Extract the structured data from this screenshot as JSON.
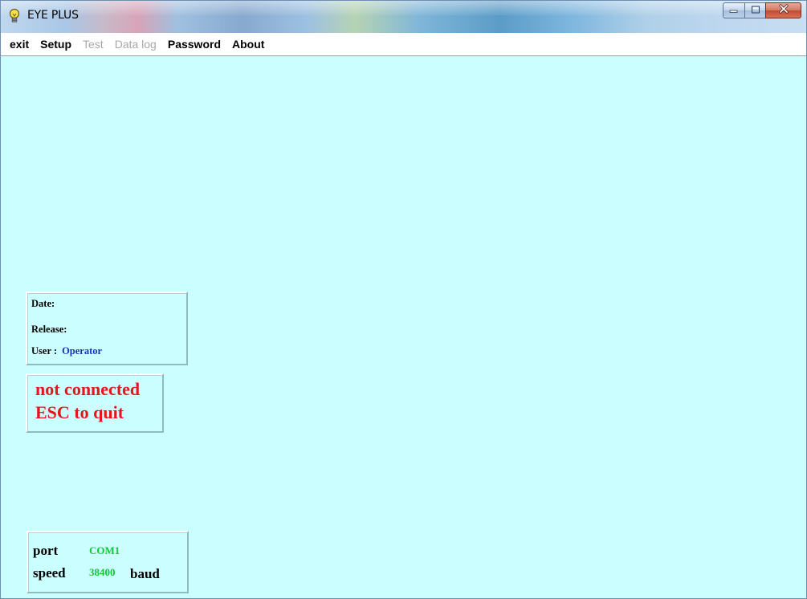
{
  "window": {
    "title": "EYE PLUS"
  },
  "menu": {
    "items": [
      {
        "label": "exit",
        "enabled": true
      },
      {
        "label": "Setup",
        "enabled": true
      },
      {
        "label": "Test",
        "enabled": false
      },
      {
        "label": "Data log",
        "enabled": false
      },
      {
        "label": "Password",
        "enabled": true
      },
      {
        "label": "About",
        "enabled": true
      }
    ]
  },
  "info": {
    "date_label": "Date:",
    "release_label": "Release:",
    "user_label": "User :",
    "user_value": "Operator"
  },
  "status": {
    "line1": "not connected",
    "line2": "ESC to quit"
  },
  "connection": {
    "port_label": "port",
    "port_value": "COM1",
    "speed_label": "speed",
    "speed_value": "38400",
    "speed_unit": "baud"
  },
  "colors": {
    "background": "#cbffff",
    "status_text": "#e8141c",
    "user_value": "#1a2fc0",
    "connection_value": "#13c63a",
    "disabled_menu": "#a8a8a8"
  },
  "icons": {
    "app": "lightbulb-icon",
    "minimize": "minimize-icon",
    "maximize": "maximize-icon",
    "close": "close-icon"
  }
}
